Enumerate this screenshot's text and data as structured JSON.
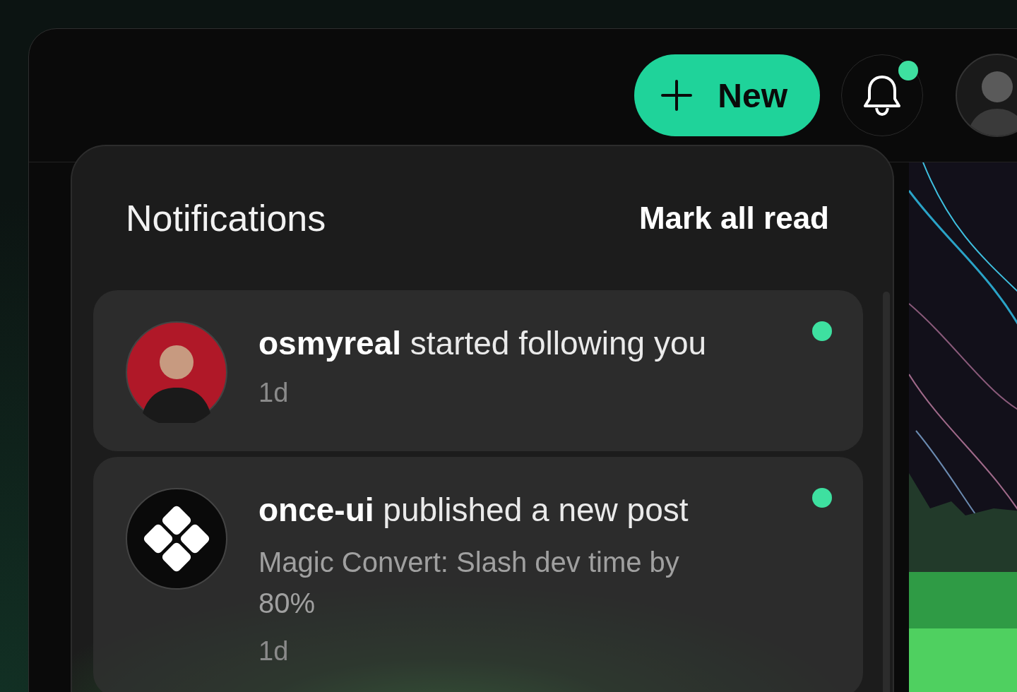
{
  "toolbar": {
    "new_button": {
      "label": "New"
    },
    "bell": {
      "unread": true
    }
  },
  "panel": {
    "title": "Notifications",
    "action": "Mark all read"
  },
  "notifications": [
    {
      "kind": "user",
      "message": "**osmyreal** started following you",
      "time": "1d",
      "unread": true
    },
    {
      "kind": "brand",
      "message": "**once-ui** published a new post",
      "excerpt": "Magic Convert: Slash dev time by 80%",
      "time": "1d",
      "unread": true
    }
  ]
}
